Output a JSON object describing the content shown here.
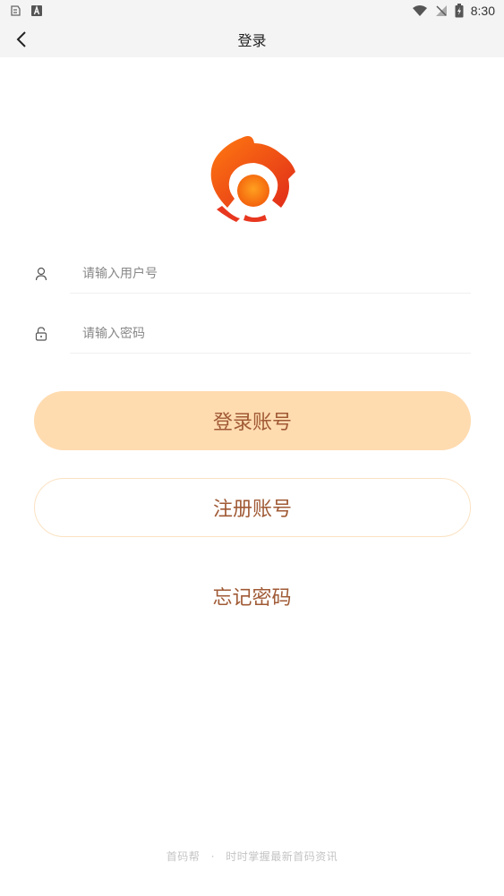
{
  "status_bar": {
    "time": "8:30"
  },
  "nav": {
    "title": "登录"
  },
  "form": {
    "username_placeholder": "请输入用户号",
    "password_placeholder": "请输入密码"
  },
  "actions": {
    "login_label": "登录账号",
    "register_label": "注册账号",
    "forgot_label": "忘记密码"
  },
  "footer": {
    "brand": "首码帮",
    "separator": "·",
    "slogan": "时时掌握最新首码资讯"
  },
  "colors": {
    "accent_text": "#a05a35",
    "login_button_bg": "#ffdbb0",
    "register_border": "#fbe2c2",
    "logo_red": "#e8371f",
    "logo_orange": "#ff8a10"
  }
}
